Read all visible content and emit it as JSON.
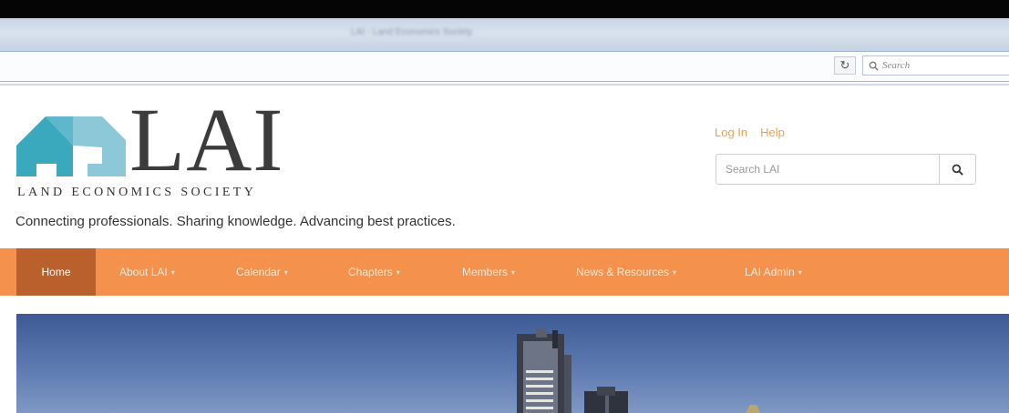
{
  "browser": {
    "title": "LAI - Land Economics Society",
    "search_placeholder": "Search",
    "reload_icon": "reload-icon"
  },
  "brand": {
    "logo_text": "LAI",
    "subtitle": "LAND ECONOMICS SOCIETY",
    "tagline": "Connecting professionals.  Sharing knowledge.  Advancing best practices.",
    "colors": {
      "mark_dark": "#3aa8bd",
      "mark_light": "#8dc8d9",
      "logo_text": "#3b3b3b"
    }
  },
  "utility": {
    "login": "Log In",
    "help": "Help"
  },
  "site_search": {
    "placeholder": "Search LAI"
  },
  "nav": {
    "items": [
      {
        "label": "Home",
        "active": true
      },
      {
        "label": "About LAI",
        "dropdown": true
      },
      {
        "label": "Calendar",
        "dropdown": true
      },
      {
        "label": "Chapters",
        "dropdown": true
      },
      {
        "label": "Members",
        "dropdown": true
      },
      {
        "label": "News & Resources",
        "dropdown": true
      },
      {
        "label": "LAI Admin",
        "dropdown": true
      }
    ],
    "caret": "▾",
    "colors": {
      "bar": "#f3914d",
      "active": "#b9602c",
      "text": "#fde8d6"
    }
  },
  "hero": {
    "description_icon": "city-skyline-image"
  }
}
